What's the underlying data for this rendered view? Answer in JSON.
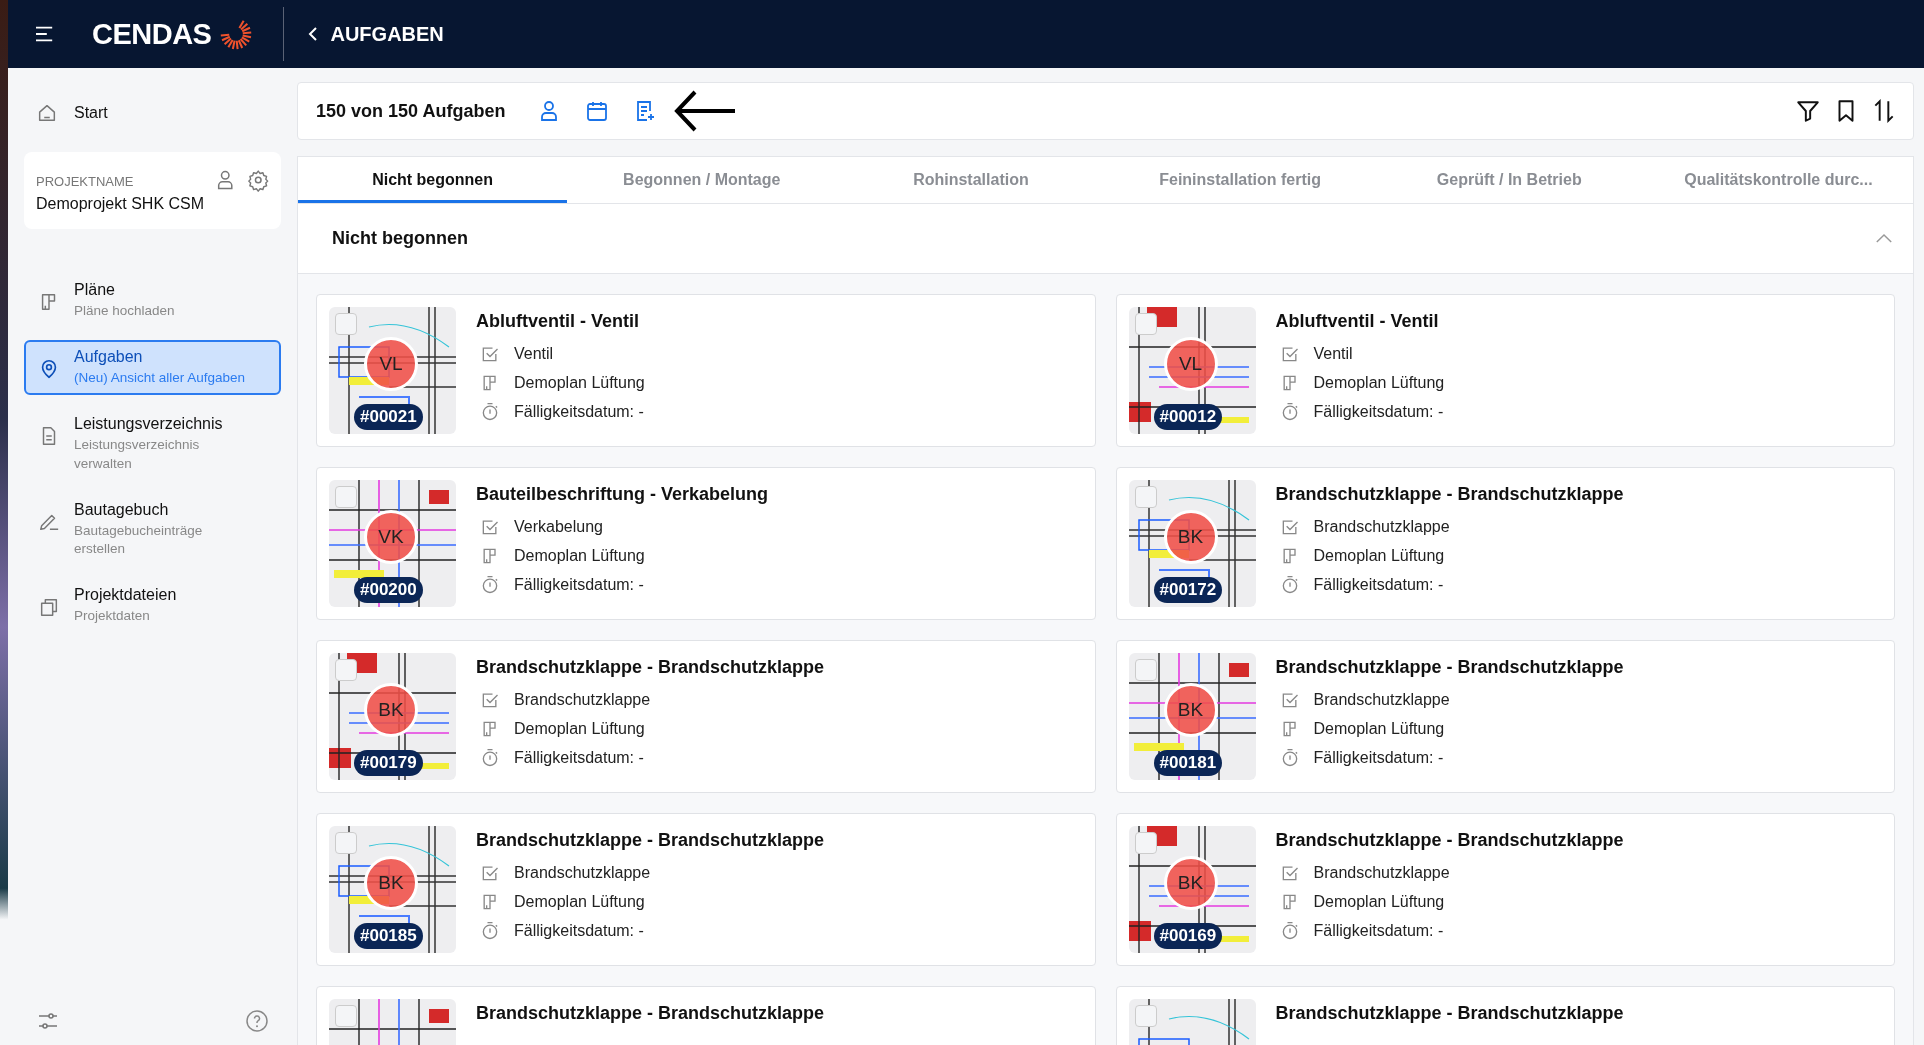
{
  "top_bar": {
    "logo": "CENDAS",
    "back_label": "AUFGABEN"
  },
  "sidebar": {
    "start": "Start",
    "project": {
      "label": "PROJEKTNAME",
      "name": "Demoprojekt SHK CSM"
    },
    "items": [
      {
        "kind": "plans",
        "title": "Pläne",
        "subtitle": "Pläne hochladen",
        "selected": false
      },
      {
        "kind": "tasks",
        "title": "Aufgaben",
        "subtitle": "(Neu) Ansicht aller Aufgaben",
        "selected": true
      },
      {
        "kind": "document",
        "title": "Leistungsverzeichnis",
        "subtitle": "Leistungsverzeichnis verwalten",
        "selected": false
      },
      {
        "kind": "pencil",
        "title": "Bautagebuch",
        "subtitle": "Bautagebucheinträge erstellen",
        "selected": false
      },
      {
        "kind": "files",
        "title": "Projektdateien",
        "subtitle": "Projektdaten",
        "selected": false
      }
    ]
  },
  "toolbar": {
    "count": "150 von 150 Aufgaben"
  },
  "tabs": [
    {
      "label": "Nicht begonnen",
      "selected": true
    },
    {
      "label": "Begonnen / Montage",
      "selected": false
    },
    {
      "label": "Rohinstallation",
      "selected": false
    },
    {
      "label": "Feininstallation fertig",
      "selected": false
    },
    {
      "label": "Geprüft / In Betrieb",
      "selected": false
    },
    {
      "label": "Qualitätskontrolle durc...",
      "selected": false
    }
  ],
  "section": {
    "title": "Nicht begonnen",
    "expanded": true
  },
  "tasks": [
    {
      "title": "Abluftventil - Ventil",
      "initials": "VL",
      "number": "#00021",
      "checked": false,
      "category": "Ventil",
      "plan": "Demoplan Lüftung",
      "due": "Fälligkeitsdatum: -"
    },
    {
      "title": "Abluftventil - Ventil",
      "initials": "VL",
      "number": "#00012",
      "checked": false,
      "category": "Ventil",
      "plan": "Demoplan Lüftung",
      "due": "Fälligkeitsdatum: -"
    },
    {
      "title": "Bauteilbeschriftung - Verkabelung",
      "initials": "VK",
      "number": "#00200",
      "checked": false,
      "category": "Verkabelung",
      "plan": "Demoplan Lüftung",
      "due": "Fälligkeitsdatum: -"
    },
    {
      "title": "Brandschutzklappe - Brandschutzklappe",
      "initials": "BK",
      "number": "#00172",
      "checked": false,
      "category": "Brandschutzklappe",
      "plan": "Demoplan Lüftung",
      "due": "Fälligkeitsdatum: -"
    },
    {
      "title": "Brandschutzklappe - Brandschutzklappe",
      "initials": "BK",
      "number": "#00179",
      "checked": false,
      "category": "Brandschutzklappe",
      "plan": "Demoplan Lüftung",
      "due": "Fälligkeitsdatum: -"
    },
    {
      "title": "Brandschutzklappe - Brandschutzklappe",
      "initials": "BK",
      "number": "#00181",
      "checked": false,
      "category": "Brandschutzklappe",
      "plan": "Demoplan Lüftung",
      "due": "Fälligkeitsdatum: -"
    },
    {
      "title": "Brandschutzklappe - Brandschutzklappe",
      "initials": "BK",
      "number": "#00185",
      "checked": false,
      "category": "Brandschutzklappe",
      "plan": "Demoplan Lüftung",
      "due": "Fälligkeitsdatum: -"
    },
    {
      "title": "Brandschutzklappe - Brandschutzklappe",
      "initials": "BK",
      "number": "#00169",
      "checked": false,
      "category": "Brandschutzklappe",
      "plan": "Demoplan Lüftung",
      "due": "Fälligkeitsdatum: -"
    },
    {
      "title": "Brandschutzklappe - Brandschutzklappe",
      "checked": false
    },
    {
      "title": "Brandschutzklappe - Brandschutzklappe",
      "checked": false
    }
  ]
}
